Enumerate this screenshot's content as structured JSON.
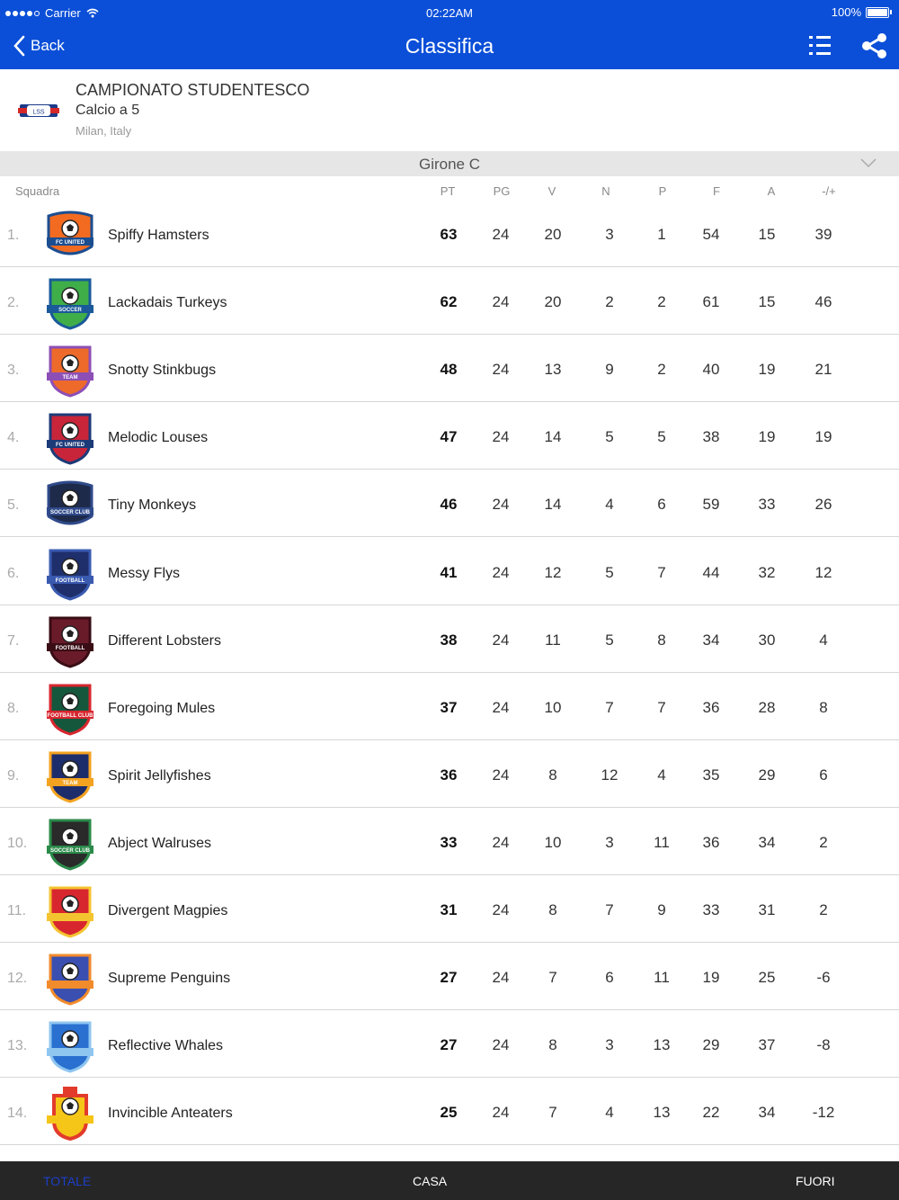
{
  "status_bar": {
    "carrier": "Carrier",
    "time": "02:22AM",
    "battery": "100%"
  },
  "nav": {
    "back_label": "Back",
    "title": "Classifica"
  },
  "championship": {
    "logo_text": "LSS",
    "title": "CAMPIONATO STUDENTESCO",
    "subtitle": "Calcio a 5",
    "location": "Milan, Italy"
  },
  "group": {
    "label": "Girone C"
  },
  "columns": {
    "team": "Squadra",
    "pt": "PT",
    "pg": "PG",
    "v": "V",
    "n": "N",
    "p": "P",
    "f": "F",
    "a": "A",
    "diff": "-/+"
  },
  "teams": [
    {
      "pos": "1.",
      "name": "Spiffy Hamsters",
      "pt": "63",
      "pg": "24",
      "v": "20",
      "n": "3",
      "p": "1",
      "f": "54",
      "a": "15",
      "diff": "39",
      "logo": "fc-united-orange-badge",
      "logo_text": "FC UNITED"
    },
    {
      "pos": "2.",
      "name": "Lackadais Turkeys",
      "pt": "62",
      "pg": "24",
      "v": "20",
      "n": "2",
      "p": "2",
      "f": "61",
      "a": "15",
      "diff": "46",
      "logo": "soccer-green-shield",
      "logo_text": "SOCCER"
    },
    {
      "pos": "3.",
      "name": "Snotty Stinkbugs",
      "pt": "48",
      "pg": "24",
      "v": "13",
      "n": "9",
      "p": "2",
      "f": "40",
      "a": "19",
      "diff": "21",
      "logo": "team-orange-purple-shield",
      "logo_text": "TEAM"
    },
    {
      "pos": "4.",
      "name": "Melodic Louses",
      "pt": "47",
      "pg": "24",
      "v": "14",
      "n": "5",
      "p": "5",
      "f": "38",
      "a": "19",
      "diff": "19",
      "logo": "fc-united-red-shield",
      "logo_text": "FC UNITED"
    },
    {
      "pos": "5.",
      "name": "Tiny Monkeys",
      "pt": "46",
      "pg": "24",
      "v": "14",
      "n": "4",
      "p": "6",
      "f": "59",
      "a": "33",
      "diff": "26",
      "logo": "soccer-club-navy-badge",
      "logo_text": "SOCCER CLUB"
    },
    {
      "pos": "6.",
      "name": "Messy Flys",
      "pt": "41",
      "pg": "24",
      "v": "12",
      "n": "5",
      "p": "7",
      "f": "44",
      "a": "32",
      "diff": "12",
      "logo": "football-navy-shield",
      "logo_text": "FOOTBALL"
    },
    {
      "pos": "7.",
      "name": "Different Lobsters",
      "pt": "38",
      "pg": "24",
      "v": "11",
      "n": "5",
      "p": "8",
      "f": "34",
      "a": "30",
      "diff": "4",
      "logo": "football-maroon-shield",
      "logo_text": "FOOTBALL"
    },
    {
      "pos": "8.",
      "name": "Foregoing Mules",
      "pt": "37",
      "pg": "24",
      "v": "10",
      "n": "7",
      "p": "7",
      "f": "36",
      "a": "28",
      "diff": "8",
      "logo": "football-club-green-red-shield",
      "logo_text": "FOOTBALL CLUB"
    },
    {
      "pos": "9.",
      "name": "Spirit Jellyfishes",
      "pt": "36",
      "pg": "24",
      "v": "8",
      "n": "12",
      "p": "4",
      "f": "35",
      "a": "29",
      "diff": "6",
      "logo": "team-navy-flame-shield",
      "logo_text": "TEAM"
    },
    {
      "pos": "10.",
      "name": "Abject Walruses",
      "pt": "33",
      "pg": "24",
      "v": "10",
      "n": "3",
      "p": "11",
      "f": "36",
      "a": "34",
      "diff": "2",
      "logo": "soccer-club-dark-green-shield",
      "logo_text": "SOCCER CLUB"
    },
    {
      "pos": "11.",
      "name": "Divergent Magpies",
      "pt": "31",
      "pg": "24",
      "v": "8",
      "n": "7",
      "p": "9",
      "f": "33",
      "a": "31",
      "diff": "2",
      "logo": "crown-red-shield",
      "logo_text": ""
    },
    {
      "pos": "12.",
      "name": "Supreme Penguins",
      "pt": "27",
      "pg": "24",
      "v": "7",
      "n": "6",
      "p": "11",
      "f": "19",
      "a": "25",
      "diff": "-6",
      "logo": "blue-orange-shield",
      "logo_text": ""
    },
    {
      "pos": "13.",
      "name": "Reflective Whales",
      "pt": "27",
      "pg": "24",
      "v": "8",
      "n": "3",
      "p": "13",
      "f": "29",
      "a": "37",
      "diff": "-8",
      "logo": "blue-striped-shield",
      "logo_text": ""
    },
    {
      "pos": "14.",
      "name": "Invincible Anteaters",
      "pt": "25",
      "pg": "24",
      "v": "7",
      "n": "4",
      "p": "13",
      "f": "22",
      "a": "34",
      "diff": "-12",
      "logo": "yellow-red-crest",
      "logo_text": ""
    }
  ],
  "tabs": {
    "totale": "TOTALE",
    "casa": "CASA",
    "fuori": "FUORI"
  },
  "colors": {
    "nav_blue": "#0b4fd8",
    "tab_bar": "#262626",
    "active_tab": "#1c3fc8",
    "group_bar": "#e6e6e6"
  }
}
